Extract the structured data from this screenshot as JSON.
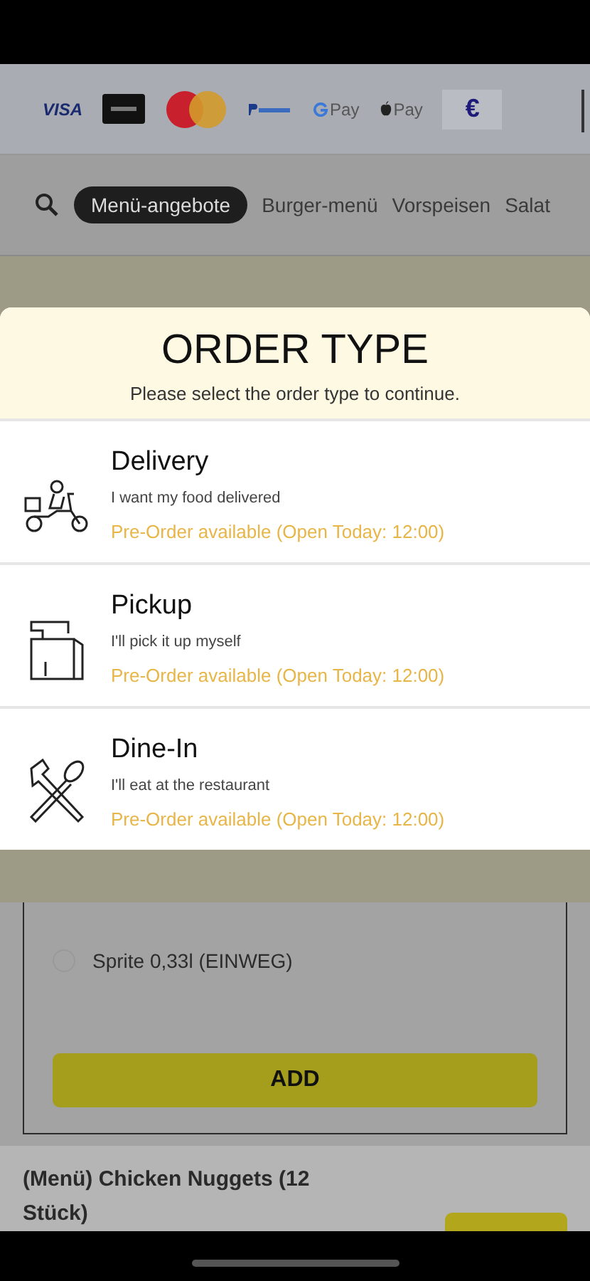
{
  "payment_methods": [
    {
      "kind": "visa",
      "label": "VISA"
    },
    {
      "kind": "sofort"
    },
    {
      "kind": "mastercard"
    },
    {
      "kind": "paypal"
    },
    {
      "kind": "gpay",
      "label": "Pay"
    },
    {
      "kind": "applepay",
      "label": "Pay"
    },
    {
      "kind": "cash",
      "label": "€"
    }
  ],
  "categories": [
    {
      "label": "Menü-angebote",
      "selected": true
    },
    {
      "label": "Burger-menü",
      "selected": false
    },
    {
      "label": "Vorspeisen",
      "selected": false
    },
    {
      "label": "Salat",
      "selected": false
    }
  ],
  "order_type": {
    "title": "ORDER TYPE",
    "subtitle": "Please select the order type to continue.",
    "options": [
      {
        "kind": "delivery",
        "name": "Delivery",
        "description": "I want my food delivered",
        "status": "Pre-Order available (Open Today: 12:00)"
      },
      {
        "kind": "pickup",
        "name": "Pickup",
        "description": "I'll pick it up myself",
        "status": "Pre-Order available (Open Today: 12:00)"
      },
      {
        "kind": "dine-in",
        "name": "Dine-In",
        "description": "I'll eat at the restaurant",
        "status": "Pre-Order available (Open Today: 12:00)"
      }
    ]
  },
  "drink_choices": [
    {
      "label": "Sprite 0,33l (EINWEG)",
      "selected": false
    }
  ],
  "add_button": "ADD",
  "product": {
    "name": "(Menü) Chicken Nuggets (12 Stück)"
  }
}
